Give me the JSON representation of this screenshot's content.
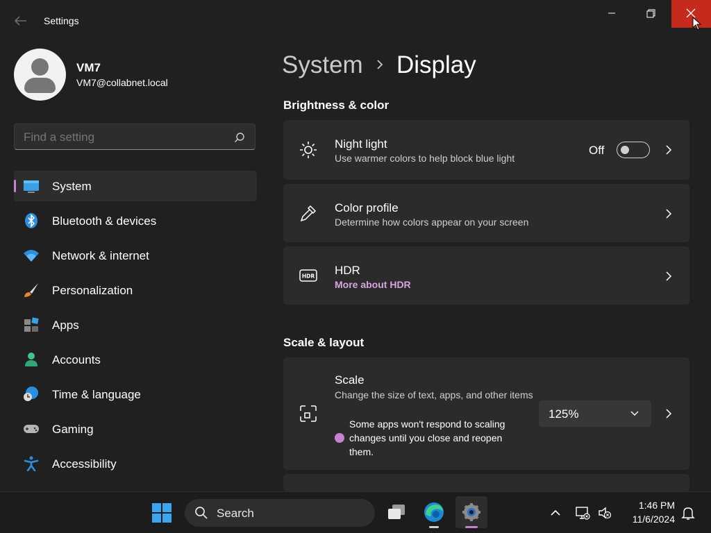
{
  "window": {
    "app_title": "Settings"
  },
  "profile": {
    "name": "VM7",
    "email": "VM7@collabnet.local"
  },
  "search": {
    "placeholder": "Find a setting"
  },
  "nav": {
    "items": [
      {
        "label": "System",
        "icon": "system-icon",
        "active": true
      },
      {
        "label": "Bluetooth & devices",
        "icon": "bluetooth-icon"
      },
      {
        "label": "Network & internet",
        "icon": "wifi-icon"
      },
      {
        "label": "Personalization",
        "icon": "brush-icon"
      },
      {
        "label": "Apps",
        "icon": "apps-icon"
      },
      {
        "label": "Accounts",
        "icon": "accounts-icon"
      },
      {
        "label": "Time & language",
        "icon": "time-language-icon"
      },
      {
        "label": "Gaming",
        "icon": "gamepad-icon"
      },
      {
        "label": "Accessibility",
        "icon": "accessibility-icon"
      }
    ]
  },
  "breadcrumb": {
    "parent": "System",
    "current": "Display"
  },
  "sections": {
    "brightness": {
      "title": "Brightness & color",
      "night_light": {
        "title": "Night light",
        "subtitle": "Use warmer colors to help block blue light",
        "toggle_label": "Off",
        "toggle_on": false
      },
      "color_profile": {
        "title": "Color profile",
        "subtitle": "Determine how colors appear on your screen"
      },
      "hdr": {
        "title": "HDR",
        "link": "More about HDR"
      }
    },
    "scale_layout": {
      "title": "Scale & layout",
      "scale": {
        "title": "Scale",
        "subtitle": "Change the size of text, apps, and other items",
        "warning": "Some apps won't respond to scaling changes until you close and reopen them.",
        "value": "125%"
      }
    }
  },
  "taskbar": {
    "search_label": "Search",
    "time": "1:46 PM",
    "date": "11/6/2024"
  },
  "colors": {
    "accent": "#c97fd4",
    "close_button": "#c42b1c",
    "background": "#202020",
    "card": "#2b2b2b"
  }
}
